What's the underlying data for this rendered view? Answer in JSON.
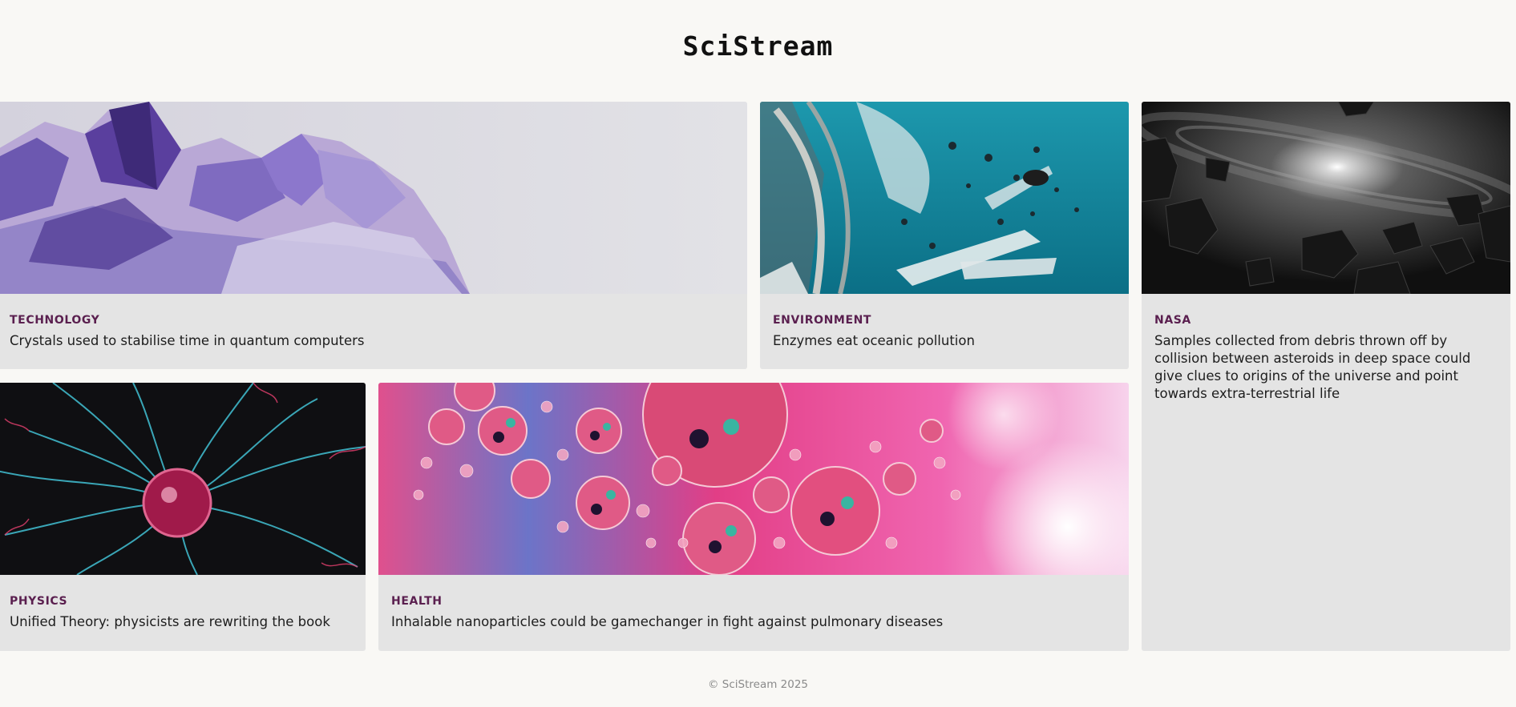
{
  "site": {
    "title": "SciStream"
  },
  "cards": [
    {
      "category": "TECHNOLOGY",
      "headline": "Crystals used to stabilise time in quantum computers",
      "image": "amethyst-crystals-image"
    },
    {
      "category": "ENVIRONMENT",
      "headline": "Enzymes eat oceanic pollution",
      "image": "ocean-plastic-image"
    },
    {
      "category": "NASA",
      "headline": "Samples collected from debris thrown off by collision between asteroids in deep space could give clues to origins of the universe and point towards extra-terrestrial life",
      "image": "asteroid-field-image"
    },
    {
      "category": "PHYSICS",
      "headline": "Unified Theory: physicists are rewriting the book",
      "image": "plasma-ball-image"
    },
    {
      "category": "HEALTH",
      "headline": "Inhalable nanoparticles could be gamechanger in fight against pulmonary diseases",
      "image": "pink-bubbles-image"
    }
  ],
  "footer": {
    "text": "© SciStream 2025"
  },
  "colors": {
    "background": "#f9f8f5",
    "card": "#e4e4e4",
    "category": "#5a1f4f",
    "text": "#1d1d1d"
  }
}
